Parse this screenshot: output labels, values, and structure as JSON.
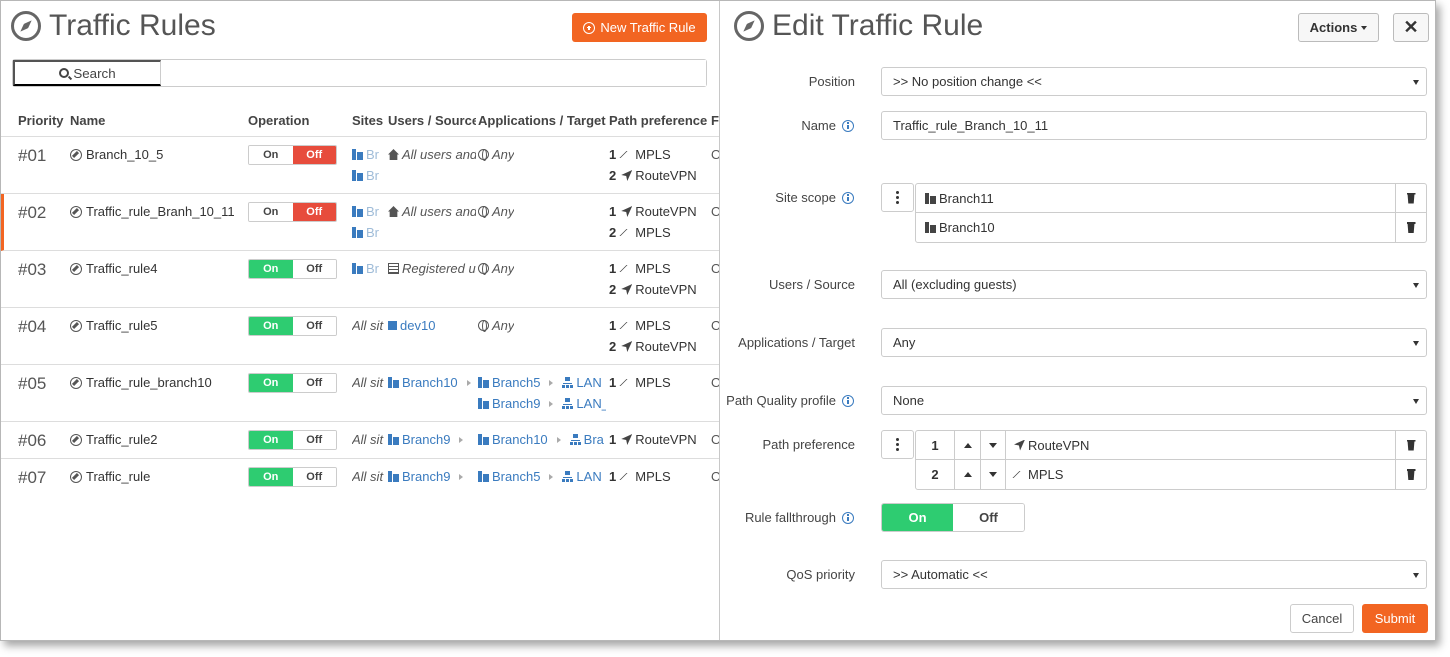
{
  "left": {
    "title": "Traffic Rules",
    "new_button": "New Traffic Rule",
    "search_button": "Search",
    "search_value": "",
    "columns": [
      "Priority",
      "Name",
      "Operation",
      "Sites",
      "Users / Source",
      "Applications / Target",
      "Path preference",
      "Fa"
    ],
    "toggle_on": "On",
    "toggle_off": "Off",
    "rows": [
      {
        "priority": "#01",
        "name": "Branch_10_5",
        "state": "off",
        "site1": "Br",
        "site2": "Br",
        "users": "All users and",
        "target": "Any",
        "path1_num": "1",
        "path1": "MPLS",
        "path2_num": "2",
        "path2": "RouteVPN",
        "fa": "O"
      },
      {
        "priority": "#02",
        "name": "Traffic_rule_Branh_10_11",
        "state": "off",
        "site1": "Br",
        "site2": "Br",
        "users": "All users and",
        "target": "Any",
        "path1_num": "1",
        "path1": "RouteVPN",
        "path2_num": "2",
        "path2": "MPLS",
        "fa": "O"
      },
      {
        "priority": "#03",
        "name": "Traffic_rule4",
        "state": "on",
        "site1": "Br",
        "users": "Registered us",
        "target": "Any",
        "path1_num": "1",
        "path1": "MPLS",
        "path2_num": "2",
        "path2": "RouteVPN",
        "fa": "O"
      },
      {
        "priority": "#04",
        "name": "Traffic_rule5",
        "state": "on",
        "site1": "All sit",
        "users": "dev10",
        "target": "Any",
        "path1_num": "1",
        "path1": "MPLS",
        "path2_num": "2",
        "path2": "RouteVPN",
        "fa": "O"
      },
      {
        "priority": "#05",
        "name": "Traffic_rule_branch10",
        "state": "on",
        "site1": "All sit",
        "users": "Branch10",
        "target_a": "Branch5",
        "target_b": "Branch9",
        "lan_a": "LAN",
        "lan_b": "LAN_",
        "path1_num": "1",
        "path1": "MPLS",
        "fa": "O"
      },
      {
        "priority": "#06",
        "name": "Traffic_rule2",
        "state": "on",
        "site1": "All sit",
        "users": "Branch9",
        "target_a": "Branch10",
        "lan_a": "Bra",
        "path1_num": "1",
        "path1": "RouteVPN",
        "fa": "O"
      },
      {
        "priority": "#07",
        "name": "Traffic_rule",
        "state": "on",
        "site1": "All sit",
        "users": "Branch9",
        "target_a": "Branch5",
        "lan_a": "LAN",
        "path1_num": "1",
        "path1": "MPLS",
        "fa": "O"
      }
    ]
  },
  "edit": {
    "title": "Edit Traffic Rule",
    "actions_label": "Actions",
    "close_label": "✕",
    "position_label": "Position",
    "position_value": ">> No position change <<",
    "name_label": "Name",
    "name_value": "Traffic_rule_Branch_10_11",
    "site_scope_label": "Site scope",
    "site_scope": [
      "Branch11",
      "Branch10"
    ],
    "users_label": "Users / Source",
    "users_value": "All (excluding guests)",
    "apps_label": "Applications / Target",
    "apps_value": "Any",
    "pq_label": "Path Quality profile",
    "pq_value": "None",
    "path_pref_label": "Path preference",
    "path_pref": [
      {
        "num": "1",
        "name": "RouteVPN"
      },
      {
        "num": "2",
        "name": "MPLS"
      }
    ],
    "fallthrough_label": "Rule fallthrough",
    "fallthrough_on": "On",
    "fallthrough_off": "Off",
    "qos_label": "QoS priority",
    "qos_value": ">> Automatic <<",
    "cancel": "Cancel",
    "submit": "Submit"
  },
  "colors": {
    "accent": "#f26522",
    "on": "#2ecc71",
    "off": "#e74c3c",
    "link": "#3a7bbf"
  }
}
